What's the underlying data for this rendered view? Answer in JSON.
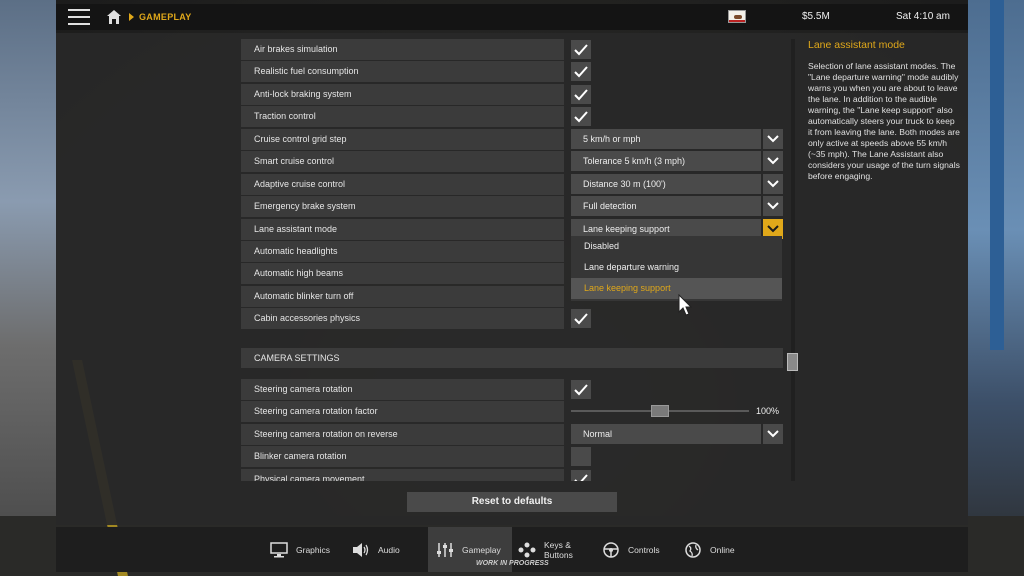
{
  "topbar": {
    "breadcrumb": "GAMEPLAY",
    "money": "$5.5M",
    "clock": "Sat 4:10 am"
  },
  "settings": {
    "rows": [
      {
        "label": "Air brakes simulation",
        "checked": true
      },
      {
        "label": "Realistic fuel consumption",
        "checked": true
      },
      {
        "label": "Anti-lock braking system",
        "checked": true
      },
      {
        "label": "Traction control",
        "checked": true
      },
      {
        "label": "Cruise control grid step",
        "value": "5 km/h or mph"
      },
      {
        "label": "Smart cruise control",
        "value": "Tolerance 5 km/h (3 mph)"
      },
      {
        "label": "Adaptive cruise control",
        "value": "Distance 30 m (100')"
      },
      {
        "label": "Emergency brake system",
        "value": "Full detection"
      },
      {
        "label": "Lane assistant mode",
        "value": "Lane keeping support"
      },
      {
        "label": "Automatic headlights"
      },
      {
        "label": "Automatic high beams"
      },
      {
        "label": "Automatic blinker turn off"
      },
      {
        "label": "Cabin accessories physics",
        "checked": true
      }
    ],
    "dropdown_options": [
      "Disabled",
      "Lane departure warning",
      "Lane keeping support"
    ],
    "camera_section": "CAMERA SETTINGS",
    "camera_rows": [
      {
        "label": "Steering camera rotation",
        "checked": true
      },
      {
        "label": "Steering camera rotation factor",
        "slider_value": "100%",
        "slider_fraction": 0.5
      },
      {
        "label": "Steering camera rotation on reverse",
        "value": "Normal"
      },
      {
        "label": "Blinker camera rotation",
        "checked": false
      },
      {
        "label": "Physical camera movement",
        "checked": true
      }
    ]
  },
  "info": {
    "title": "Lane assistant mode",
    "text": "Selection of lane assistant modes. The \"Lane departure warning\" mode audibly warns you when you are about to leave the lane. In addition to the audible warning, the \"Lane keep support\" also automatically steers your truck to keep it from leaving the lane. Both modes are only active at speeds above 55 km/h (~35 mph). The Lane Assistant also considers your usage of the turn signals before engaging."
  },
  "reset_label": "Reset to defaults",
  "nav": {
    "items": [
      {
        "label": "Graphics",
        "icon": "monitor-icon"
      },
      {
        "label": "Audio",
        "icon": "speaker-icon"
      },
      {
        "label": "Gameplay",
        "icon": "sliders-icon",
        "active": true
      },
      {
        "label": "Keys &\nButtons",
        "icon": "gamepad-icon"
      },
      {
        "label": "Controls",
        "icon": "steering-wheel-icon"
      },
      {
        "label": "Online",
        "icon": "globe-icon"
      }
    ],
    "wip": "WORK IN PROGRESS"
  },
  "colors": {
    "accent": "#e0a81a",
    "panel": "#282828",
    "row": "#3b3b3b"
  }
}
